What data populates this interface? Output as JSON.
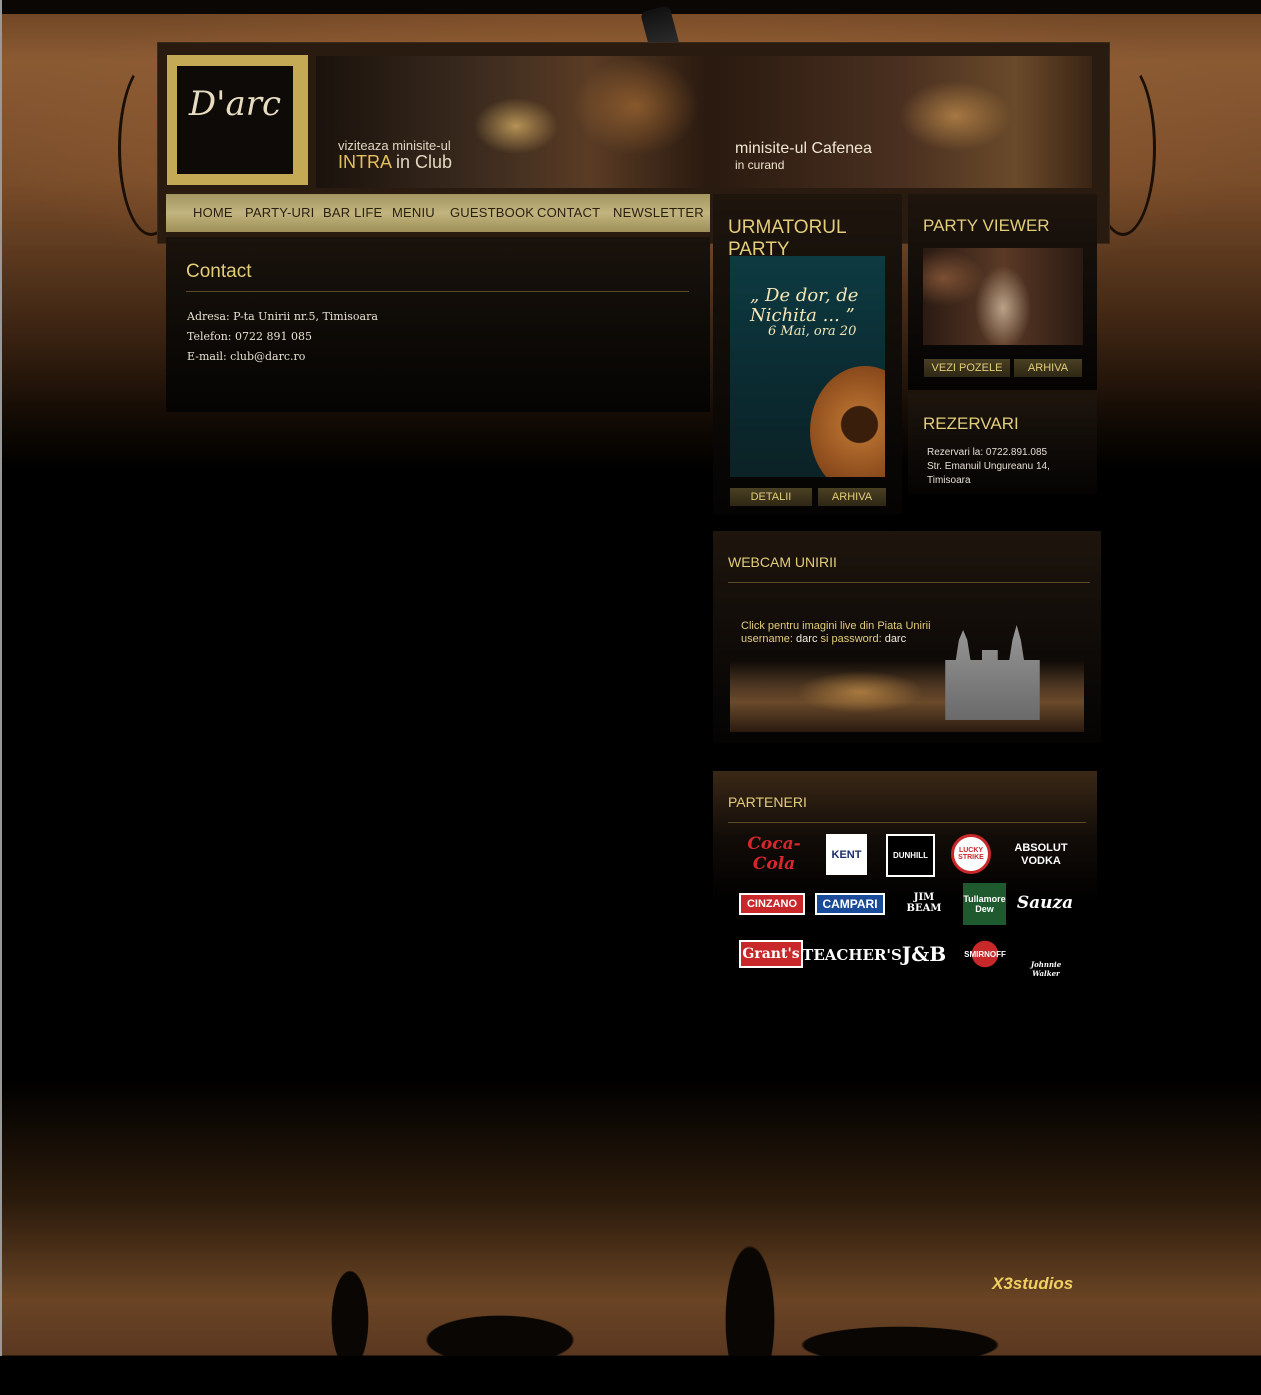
{
  "brand": {
    "logo_text": "D'arc"
  },
  "banners": {
    "intra": {
      "line1": "viziteaza minisite-ul",
      "highlight": "INTRA",
      "rest": " in Club"
    },
    "cafenea": {
      "line1": "minisite-ul Cafenea",
      "line2": "in curand"
    }
  },
  "nav": {
    "items": [
      {
        "label": "HOME"
      },
      {
        "label": "PARTY-URI"
      },
      {
        "label": "BAR LIFE"
      },
      {
        "label": "MENIU"
      },
      {
        "label": "GUESTBOOK"
      },
      {
        "label": "CONTACT"
      },
      {
        "label": "NEWSLETTER"
      }
    ]
  },
  "contact": {
    "title": "Contact",
    "address": "Adresa: P-ta Unirii nr.5, Timisoara",
    "phone": "Telefon: 0722 891 085",
    "email": "E-mail: club@darc.ro"
  },
  "next_party": {
    "title": "URMATORUL PARTY",
    "poster_title": "„ De dor, de Nichita ... ”",
    "poster_date": "6 Mai, ora 20",
    "btn_details": "DETALII",
    "btn_archive": "ARHIVA"
  },
  "party_viewer": {
    "title": "PARTY VIEWER",
    "btn_photos": "VEZI POZELE",
    "btn_archive": "ARHIVA"
  },
  "reservations": {
    "title": "REZERVARI",
    "line1": "Rezervari la: 0722.891.085",
    "line2": "Str. Emanuil Ungureanu 14,",
    "line3": "Timisoara"
  },
  "webcam": {
    "title": "WEBCAM UNIRII",
    "line1": "Click pentru imagini live din Piata Unirii",
    "username_label": "username:",
    "username_value": " darc ",
    "and_label": "si password:",
    "password_value": " darc"
  },
  "partners": {
    "title": "PARTENERI",
    "logos": [
      {
        "name": "Coca-Cola",
        "text": "Coca-Cola",
        "icon": "coca-cola-logo"
      },
      {
        "name": "Kent",
        "text": "KENT",
        "icon": "kent-logo"
      },
      {
        "name": "Dunhill",
        "text": "DUNHILL",
        "icon": "dunhill-logo"
      },
      {
        "name": "Lucky Strike",
        "text": "LUCKY STRIKE",
        "icon": "lucky-strike-logo"
      },
      {
        "name": "Absolut Vodka",
        "text": "ABSOLUT VODKA",
        "icon": "absolut-logo"
      },
      {
        "name": "Cinzano",
        "text": "CINZANO",
        "icon": "cinzano-logo"
      },
      {
        "name": "Campari",
        "text": "CAMPARI",
        "icon": "campari-logo"
      },
      {
        "name": "Jim Beam",
        "text": "JIM BEAM",
        "icon": "jim-beam-logo"
      },
      {
        "name": "Tullamore Dew",
        "text": "Tullamore Dew",
        "icon": "tullamore-logo"
      },
      {
        "name": "Sauza",
        "text": "Sauza",
        "icon": "sauza-logo"
      },
      {
        "name": "Grant's",
        "text": "Grant's",
        "icon": "grants-logo"
      },
      {
        "name": "Teacher's",
        "text": "TEACHER'S",
        "icon": "teachers-logo"
      },
      {
        "name": "J&B",
        "text": "J&B",
        "icon": "jb-logo"
      },
      {
        "name": "Smirnoff",
        "text": "SMIRNOFF",
        "icon": "smirnoff-logo"
      },
      {
        "name": "Johnnie Walker",
        "text": "Johnnie Walker",
        "icon": "johnnie-walker-logo"
      }
    ]
  },
  "footer": {
    "studio": "X3studios"
  },
  "colors": {
    "accent": "#e3cd7a",
    "nav_bg": "#c2b47e",
    "background": "#000000"
  }
}
